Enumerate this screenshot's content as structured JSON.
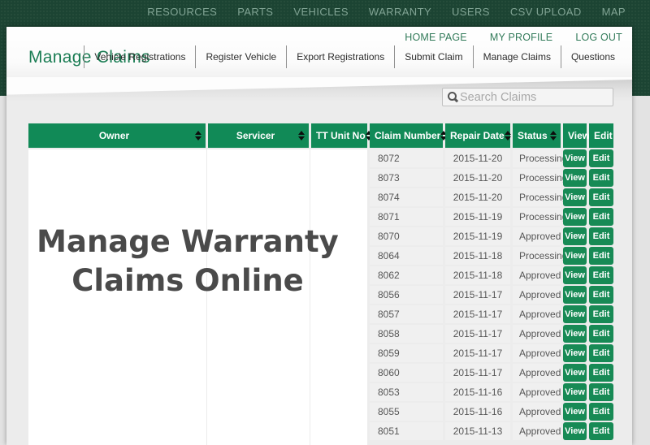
{
  "topnav": {
    "items": [
      "RESOURCES",
      "PARTS",
      "VEHICLES",
      "WARRANTY",
      "USERS",
      "CSV UPLOAD",
      "MAP"
    ]
  },
  "userbar": {
    "items": [
      "HOME PAGE",
      "MY PROFILE",
      "LOG OUT"
    ]
  },
  "header": {
    "title": "Manage Claims",
    "subnav": [
      "Vehicle Registrations",
      "Register Vehicle",
      "Export Registrations",
      "Submit Claim",
      "Manage Claims",
      "Questions"
    ]
  },
  "search": {
    "placeholder": "Search Claims"
  },
  "overlay": {
    "line1": "Manage Warranty",
    "line2": "Claims Online"
  },
  "table": {
    "columns": [
      {
        "label": "Owner"
      },
      {
        "label": "Servicer"
      },
      {
        "label": "TT Unit No"
      },
      {
        "label": "Claim Number"
      },
      {
        "label": "Repair Date"
      },
      {
        "label": "Status"
      },
      {
        "label": "View"
      },
      {
        "label": "Edit"
      }
    ],
    "view_label": "View",
    "edit_label": "Edit",
    "rows": [
      {
        "claim": "8072",
        "date": "2015-11-20",
        "status": "Processing"
      },
      {
        "claim": "8073",
        "date": "2015-11-20",
        "status": "Processing"
      },
      {
        "claim": "8074",
        "date": "2015-11-20",
        "status": "Processing"
      },
      {
        "claim": "8071",
        "date": "2015-11-19",
        "status": "Processing"
      },
      {
        "claim": "8070",
        "date": "2015-11-19",
        "status": "Approved"
      },
      {
        "claim": "8064",
        "date": "2015-11-18",
        "status": "Processing"
      },
      {
        "claim": "8062",
        "date": "2015-11-18",
        "status": "Approved"
      },
      {
        "claim": "8056",
        "date": "2015-11-17",
        "status": "Approved"
      },
      {
        "claim": "8057",
        "date": "2015-11-17",
        "status": "Approved"
      },
      {
        "claim": "8058",
        "date": "2015-11-17",
        "status": "Approved"
      },
      {
        "claim": "8059",
        "date": "2015-11-17",
        "status": "Approved"
      },
      {
        "claim": "8060",
        "date": "2015-11-17",
        "status": "Approved"
      },
      {
        "claim": "8053",
        "date": "2015-11-16",
        "status": "Approved"
      },
      {
        "claim": "8055",
        "date": "2015-11-16",
        "status": "Approved"
      },
      {
        "claim": "8051",
        "date": "2015-11-13",
        "status": "Approved"
      }
    ]
  },
  "colors": {
    "topbar_green": "#1c4433",
    "table_header_green": "#118a57",
    "button_green": "#178a55",
    "title_green": "#1b7d54",
    "link_green": "#317a59",
    "row_gray": "#f0f0f0",
    "overlay_text_gray": "#4a4a4a"
  }
}
